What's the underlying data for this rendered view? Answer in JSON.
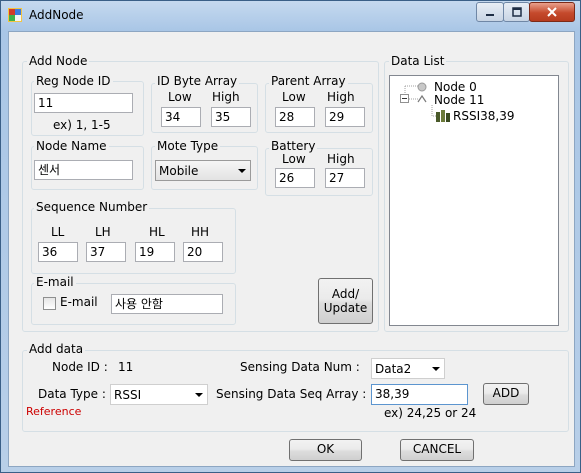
{
  "window": {
    "title": "AddNode"
  },
  "add_node": {
    "legend": "Add Node",
    "reg_node_id": {
      "legend": "Reg Node ID",
      "value": "11",
      "hint": "ex) 1, 1-5"
    },
    "id_byte_array": {
      "legend": "ID Byte Array",
      "low_label": "Low",
      "high_label": "High",
      "low": "34",
      "high": "35"
    },
    "parent_array": {
      "legend": "Parent Array",
      "low_label": "Low",
      "high_label": "High",
      "low": "28",
      "high": "29"
    },
    "node_name": {
      "legend": "Node Name",
      "value": "센서"
    },
    "mote_type": {
      "legend": "Mote Type",
      "value": "Mobile"
    },
    "battery": {
      "legend": "Battery",
      "low_label": "Low",
      "high_label": "High",
      "low": "26",
      "high": "27"
    },
    "sequence": {
      "legend": "Sequence Number",
      "ll_label": "LL",
      "lh_label": "LH",
      "hl_label": "HL",
      "hh_label": "HH",
      "ll": "36",
      "lh": "37",
      "hl": "19",
      "hh": "20"
    },
    "email": {
      "legend": "E-mail",
      "checkbox_label": "E-mail",
      "value": "사용 안함"
    },
    "add_update": {
      "line1": "Add/",
      "line2": "Update"
    }
  },
  "data_list": {
    "legend": "Data List",
    "nodes": [
      {
        "label": "Node 0"
      },
      {
        "label": "Node 11"
      },
      {
        "label": "RSSI38,39"
      }
    ]
  },
  "add_data": {
    "legend": "Add data",
    "node_id_label": "Node ID :",
    "node_id_value": "11",
    "sensing_num_label": "Sensing Data Num :",
    "sensing_num_value": "Data2",
    "data_type_label": "Data Type :",
    "data_type_value": "RSSI",
    "seq_array_label": "Sensing Data Seq Array :",
    "seq_array_value": "38,39",
    "seq_hint": "ex) 24,25 or 24",
    "add_button": "ADD",
    "reference": "Reference"
  },
  "footer": {
    "ok": "OK",
    "cancel": "CANCEL"
  }
}
